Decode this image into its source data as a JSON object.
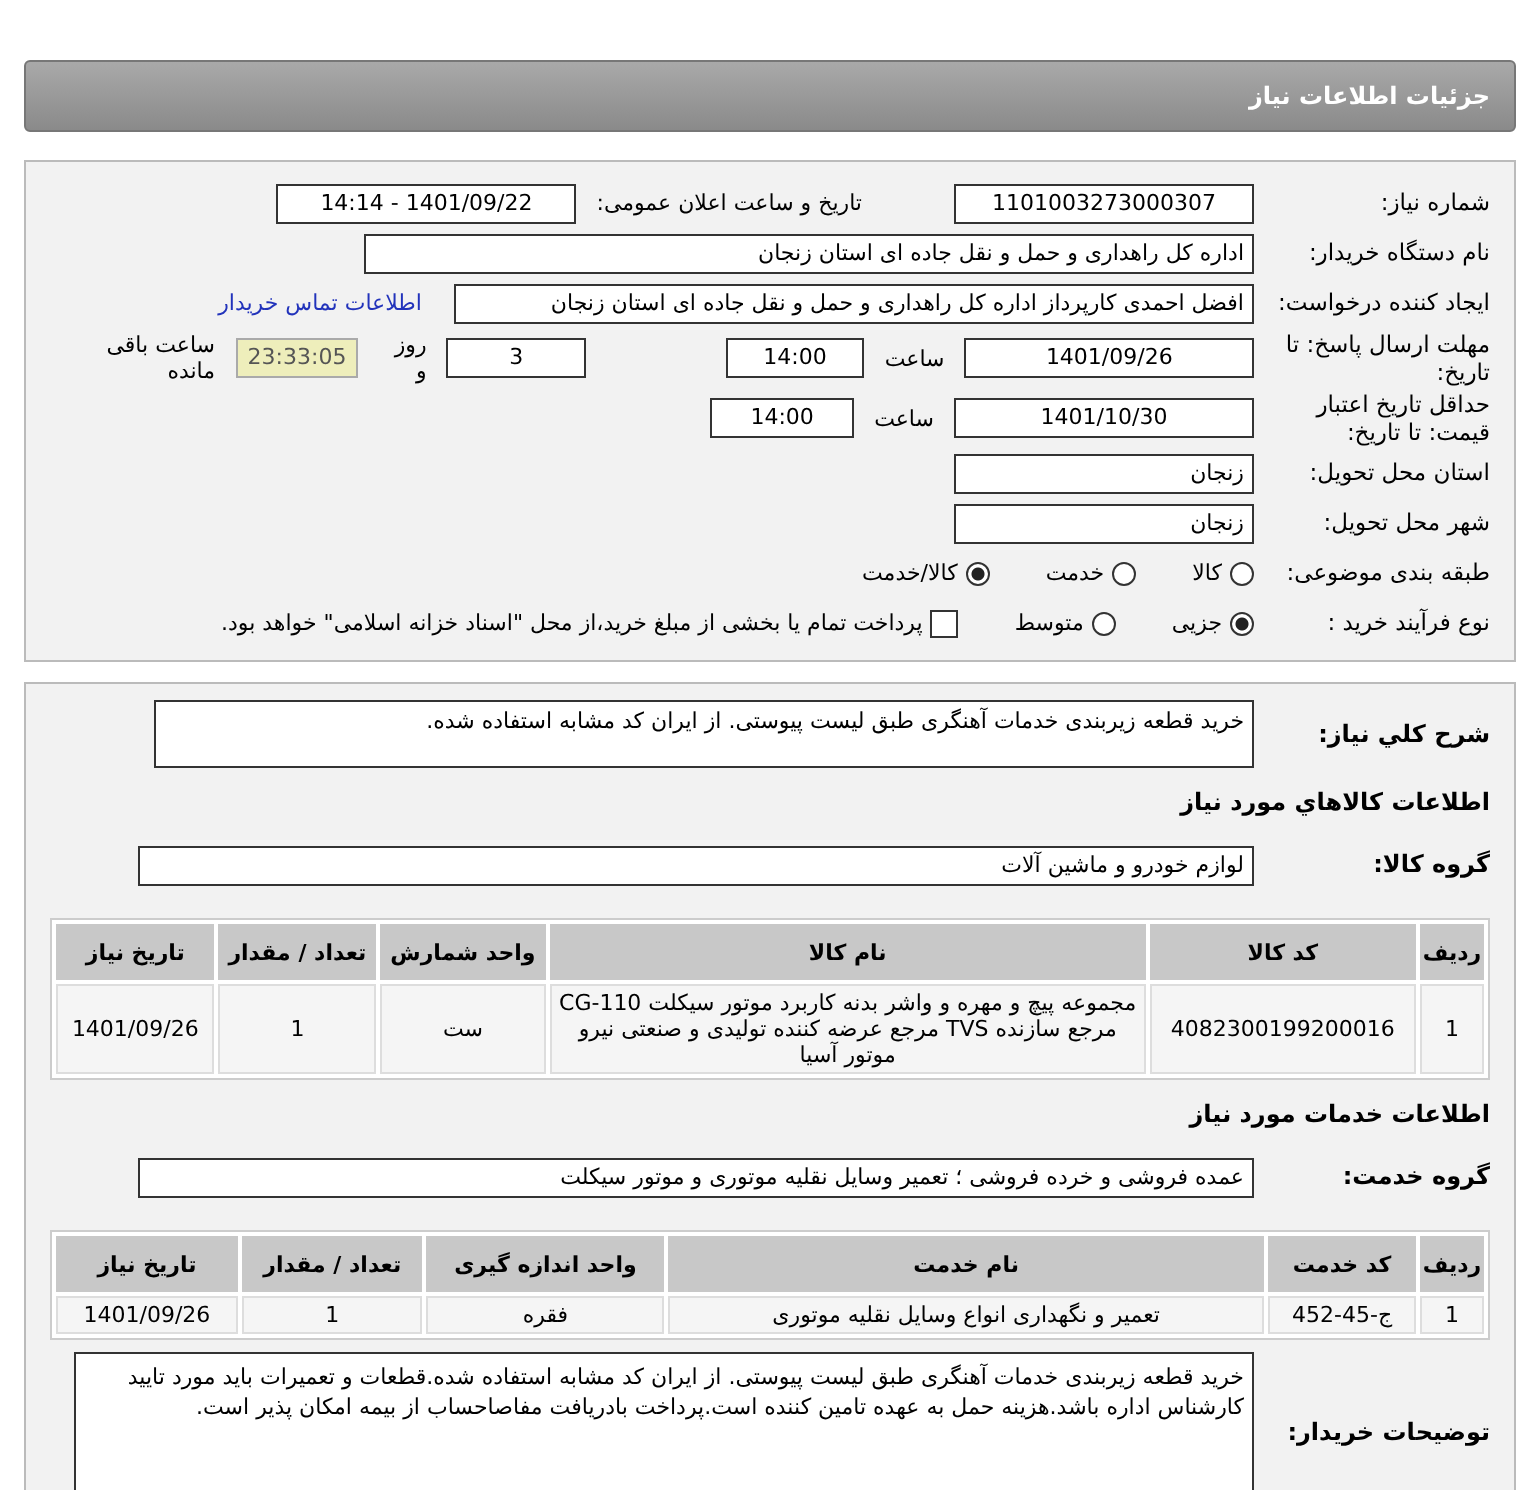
{
  "header": {
    "title": "جزئیات اطلاعات نیاز"
  },
  "need_number": {
    "label": "شماره نیاز:",
    "value": "1101003273000307"
  },
  "announce": {
    "label": "تاریخ و ساعت اعلان عمومی:",
    "value": "1401/09/22 - 14:14"
  },
  "buyer_org": {
    "label": "نام دستگاه خریدار:",
    "value": "اداره کل راهداری و حمل و نقل جاده ای استان زنجان"
  },
  "requester": {
    "label": "ایجاد کننده درخواست:",
    "value": "افضل احمدی کارپرداز اداره کل راهداری و حمل و نقل جاده ای استان زنجان",
    "link": "اطلاعات تماس خریدار"
  },
  "response_deadline": {
    "label": "مهلت ارسال پاسخ: تا تاریخ:",
    "date": "1401/09/26",
    "time_label": "ساعت",
    "time": "14:00",
    "days": "3",
    "days_label": "روز و",
    "remaining": "23:33:05",
    "remaining_label": "ساعت باقی مانده"
  },
  "price_validity": {
    "label": "حداقل تاریخ اعتبار قیمت: تا تاریخ:",
    "date": "1401/10/30",
    "time_label": "ساعت",
    "time": "14:00"
  },
  "province": {
    "label": "استان محل تحویل:",
    "value": "زنجان"
  },
  "city": {
    "label": "شهر محل تحویل:",
    "value": "زنجان"
  },
  "category": {
    "label": "طبقه بندی موضوعی:",
    "options": [
      {
        "label": "کالا",
        "selected": false
      },
      {
        "label": "خدمت",
        "selected": false
      },
      {
        "label": "کالا/خدمت",
        "selected": true
      }
    ]
  },
  "process": {
    "label": "نوع فرآیند خرید :",
    "options": [
      {
        "label": "جزیی",
        "selected": true
      },
      {
        "label": "متوسط",
        "selected": false
      }
    ],
    "payment": {
      "label": "پرداخت تمام یا بخشی از مبلغ خرید،از محل \"اسناد خزانه اسلامی\" خواهد بود.",
      "checked": false
    }
  },
  "summary": {
    "label": "شرح کلي نياز:",
    "value": "خرید قطعه زیربندی خدمات آهنگری طبق لیست پیوستی. از ایران کد مشابه استفاده شده."
  },
  "goods_title": "اطلاعات کالاهاي مورد نياز",
  "goods_group": {
    "label": "گروه کالا:",
    "value": "لوازم خودرو و ماشین آلات"
  },
  "goods_table": {
    "columns": [
      "ردیف",
      "کد کالا",
      "نام کالا",
      "واحد شمارش",
      "تعداد / مقدار",
      "تاریخ نیاز"
    ],
    "rows": [
      [
        "1",
        "4082300199200016",
        "مجموعه پیچ و مهره و واشر بدنه کاربرد موتور سیکلت CG-110 مرجع سازنده TVS مرجع عرضه کننده تولیدی و صنعتی نیرو موتور آسیا",
        "ست",
        "1",
        "1401/09/26"
      ]
    ]
  },
  "services_title": "اطلاعات خدمات مورد نیاز",
  "service_group": {
    "label": "گروه خدمت:",
    "value": "عمده فروشی و خرده فروشی ؛ تعمیر وسایل نقلیه موتوری و موتور سیکلت"
  },
  "services_table": {
    "columns": [
      "ردیف",
      "کد خدمت",
      "نام خدمت",
      "واحد اندازه گیری",
      "تعداد / مقدار",
      "تاریخ نیاز"
    ],
    "rows": [
      [
        "1",
        "ج-45-452",
        "تعمیر و نگهداری انواع وسایل نقلیه موتوری",
        "فقره",
        "1",
        "1401/09/26"
      ]
    ]
  },
  "buyer_notes": {
    "label": "توضیحات خریدار:",
    "value": "خرید قطعه زیربندی خدمات آهنگری طبق لیست پیوستی. از ایران کد مشابه استفاده شده.قطعات و تعمیرات باید مورد تایید کارشناس اداره باشد.هزینه حمل به عهده تامین کننده است.پرداخت بادریافت مفاصاحساب از بیمه امکان پذیر است."
  }
}
